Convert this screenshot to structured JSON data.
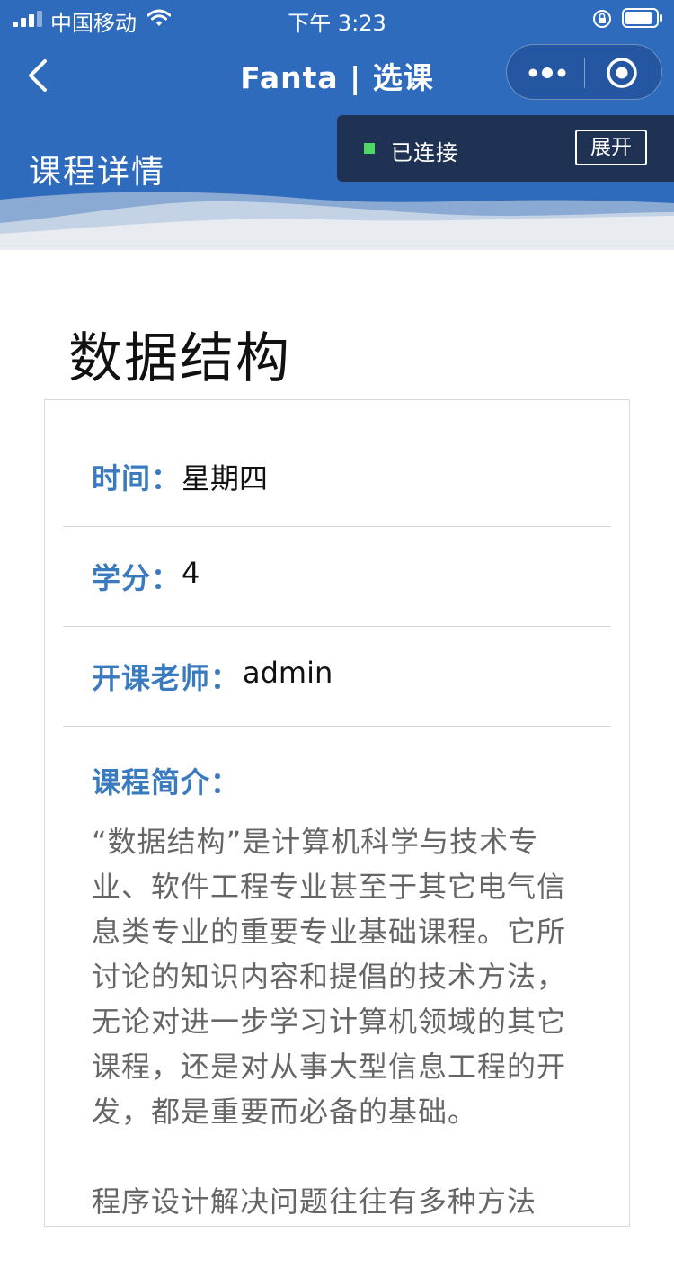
{
  "status_bar": {
    "carrier": "中国移动",
    "time": "下午 3:23"
  },
  "navbar": {
    "title": "Fanta | 选课",
    "icons": [
      "chevron-left-icon",
      "more-dots-icon",
      "close-target-icon"
    ]
  },
  "header": {
    "subtitle": "课程详情",
    "connection": {
      "status": "已连接",
      "expand_label": "展开",
      "status_color": "#4cd964"
    }
  },
  "course": {
    "name": "数据结构",
    "time_label": "时间：",
    "time_value": "星期四",
    "credit_label": "学分：",
    "credit_value": "4",
    "teacher_label": "开课老师：",
    "teacher_value": "admin",
    "intro_label": "课程简介：",
    "intro_paragraphs": [
      "“数据结构”是计算机科学与技术专业、软件工程专业甚至于其它电气信息类专业的重要专业基础课程。它所讨论的知识内容和提倡的技术方法，无论对进一步学习计算机领域的其它课程，还是对从事大型信息工程的开发，都是重要而必备的基础。",
      "程序设计解决问题往往有多种方法"
    ]
  },
  "colors": {
    "header_blue": "#2f6bbd",
    "label_blue": "#3a7bbf",
    "panel_dark": "#1f3253"
  }
}
